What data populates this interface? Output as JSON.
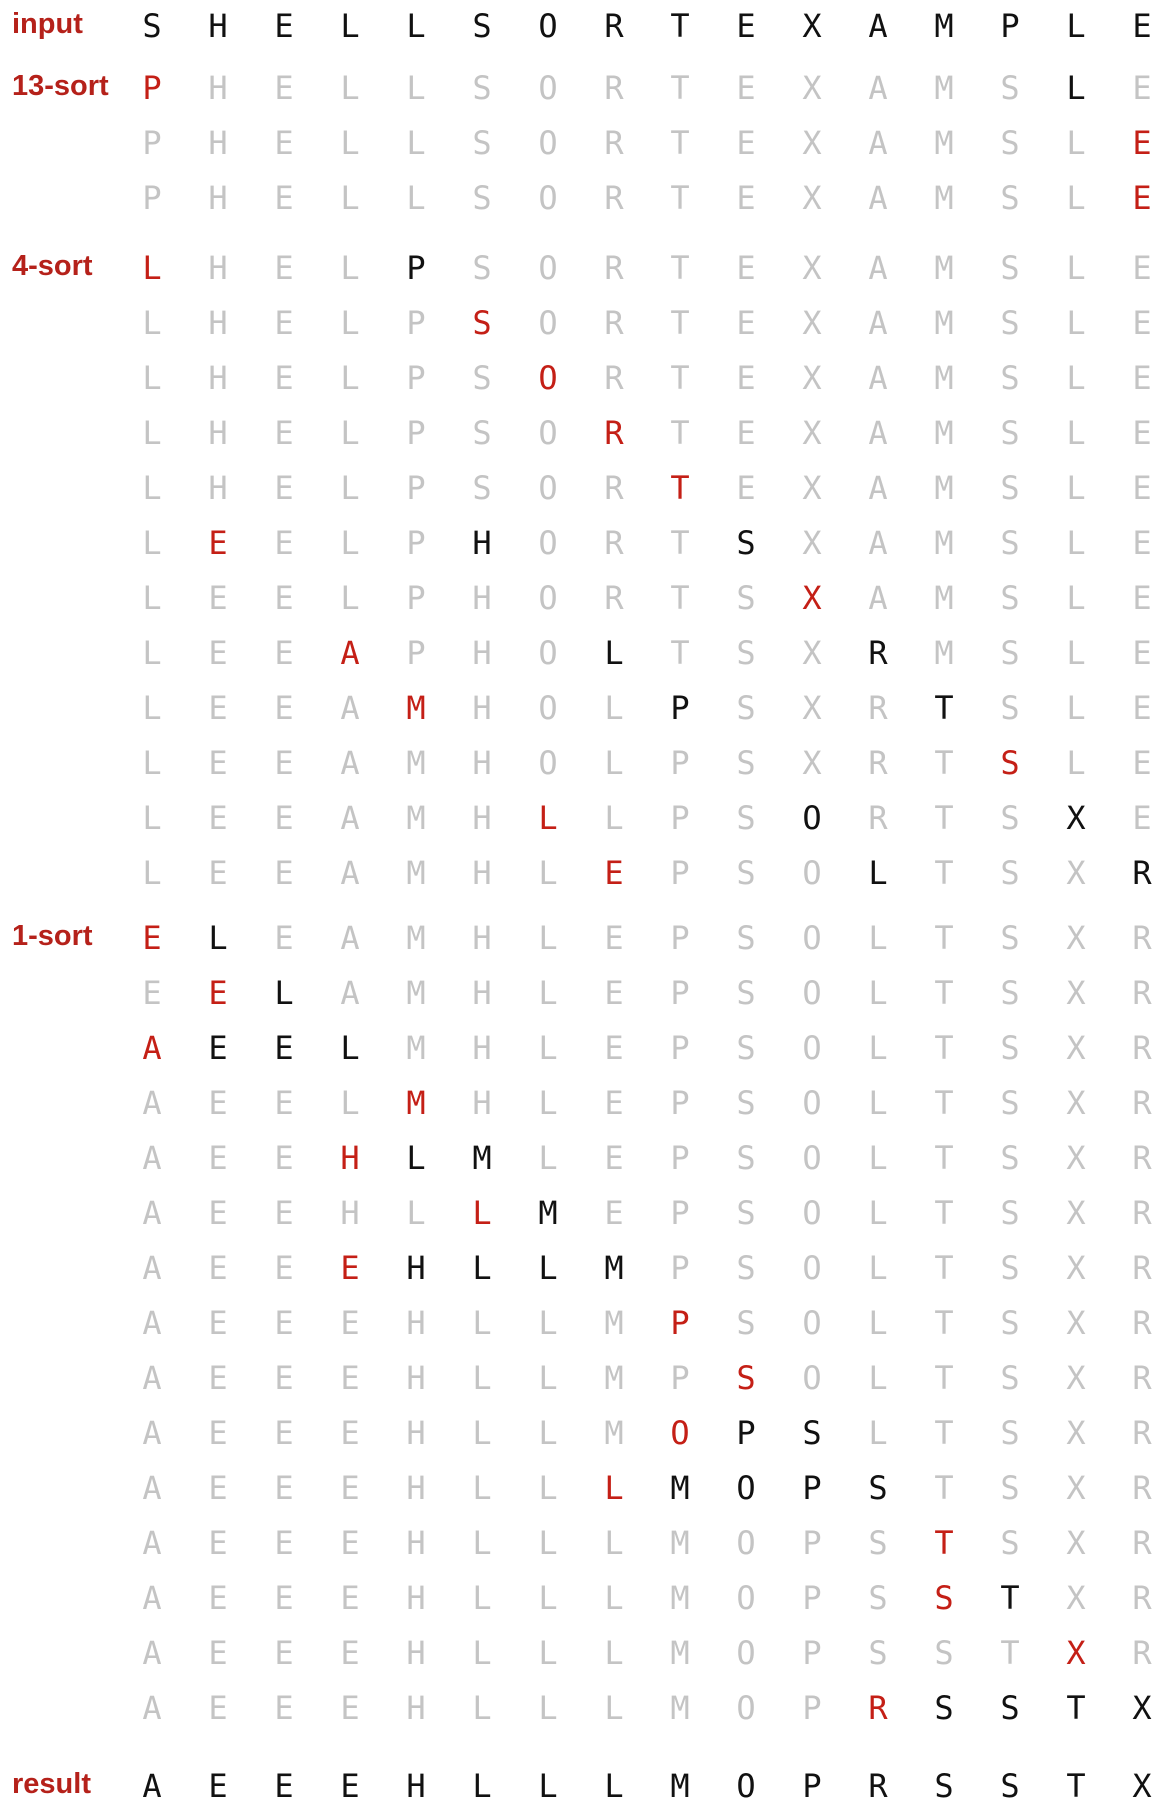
{
  "colors": {
    "black": "#111111",
    "gray": "#c4c4c4",
    "red": "#c41f16",
    "label": "#b5211a"
  },
  "labels": {
    "input": "input",
    "h13": "13-sort",
    "h4": "4-sort",
    "h1": "1-sort",
    "result": "result"
  },
  "rows": [
    {
      "section": "input",
      "letters": "SHELLSORTEXAMPLE",
      "colors": "bbbbbbbbbbbbbbbb"
    },
    {
      "section": "13-sort",
      "letters": "PHELLSORTEXAMSLE",
      "colors": "rgggggggggggggbgg"
    },
    {
      "section": "",
      "letters": "PHELLSORTEXAMSLE",
      "colors": "gggggggggggggggrg"
    },
    {
      "section": "",
      "letters": "PHELLSORTEXAMSLE",
      "colors": "gggggggggggggggr"
    },
    {
      "section": "4-sort",
      "letters": "LHELPSORTEXAMSLE",
      "colors": "rgggbggggggggggg"
    },
    {
      "section": "",
      "letters": "LHELPSORTEXAMSLE",
      "colors": "gggggrgggggggggg"
    },
    {
      "section": "",
      "letters": "LHELPSORTEXAMSLE",
      "colors": "ggggggrggggggggg"
    },
    {
      "section": "",
      "letters": "LHELPSORTEXAMSLE",
      "colors": "gggggggrgggggggg"
    },
    {
      "section": "",
      "letters": "LHELPSORTEXAMSLE",
      "colors": "ggggggggrggggggg"
    },
    {
      "section": "",
      "letters": "LEELPHORTSXAMSLE",
      "colors": "grgggbgggbgggggg"
    },
    {
      "section": "",
      "letters": "LEELPHORTSXAMSLE",
      "colors": "ggggggggggrggggg"
    },
    {
      "section": "",
      "letters": "LEEAPHOLTSXRMSLE",
      "colors": "gggrgggbgggbgggg"
    },
    {
      "section": "",
      "letters": "LEEAMHOLPSXRTSLE",
      "colors": "ggggrgggbgggbggg"
    },
    {
      "section": "",
      "letters": "LEEAMHOLPSXRTSLE",
      "colors": "gggggggggggggrgg"
    },
    {
      "section": "",
      "letters": "LEEAMHLLPSORTSXE",
      "colors": "ggggggrgggbgggbg"
    },
    {
      "section": "",
      "letters": "LEEAMHLEPSOLTSXR",
      "colors": "gggggggrgggbgggb"
    },
    {
      "section": "1-sort",
      "letters": "ELEAMHLEPSOLTSXR",
      "colors": "rbgggggggggggggg"
    },
    {
      "section": "",
      "letters": "EELAMHLEPSOLTSXR",
      "colors": "grbggggggggggggg"
    },
    {
      "section": "",
      "letters": "AEELMHLEPSOLTSXR",
      "colors": "rbbbgggggggggggg"
    },
    {
      "section": "",
      "letters": "AEELMHLEPSOLTSXR",
      "colors": "ggggrggggggggggg"
    },
    {
      "section": "",
      "letters": "AEEHLMLEPSOLTSXR",
      "colors": "gggrbbgggggggggg"
    },
    {
      "section": "",
      "letters": "AEEHLLMEPSOLTSXR",
      "colors": "gggggrbggggggggg"
    },
    {
      "section": "",
      "letters": "AEEEHLLMPSOLTSXR",
      "colors": "gggrbbbbgggggggg"
    },
    {
      "section": "",
      "letters": "AEEEHLLMPSOLTSXR",
      "colors": "ggggggggrggggggg"
    },
    {
      "section": "",
      "letters": "AEEEHLLMPSOLTSXR",
      "colors": "gggggggggrgggggg"
    },
    {
      "section": "",
      "letters": "AEEEHLLMOPSLTSXR",
      "colors": "ggggggggrbbggggg"
    },
    {
      "section": "",
      "letters": "AEEEHLLLMOPSTSXR",
      "colors": "gggggggrbbbbgggg"
    },
    {
      "section": "",
      "letters": "AEEEHLLLMOPSTSXR",
      "colors": "ggggggggggggrggg"
    },
    {
      "section": "",
      "letters": "AEEEHLLLMOPSSTXR",
      "colors": "ggggggggggggrbgg"
    },
    {
      "section": "",
      "letters": "AEEEHLLLMOPSSTXR",
      "colors": "ggggggggggggggrg"
    },
    {
      "section": "",
      "letters": "AEEEHLLLMOPRSSTX",
      "colors": "gggggggggggrbbbb"
    },
    {
      "section": "result",
      "letters": "AEEEHLLLMOPRSSTX",
      "colors": "bbbbbbbbbbbbbbbb"
    }
  ]
}
